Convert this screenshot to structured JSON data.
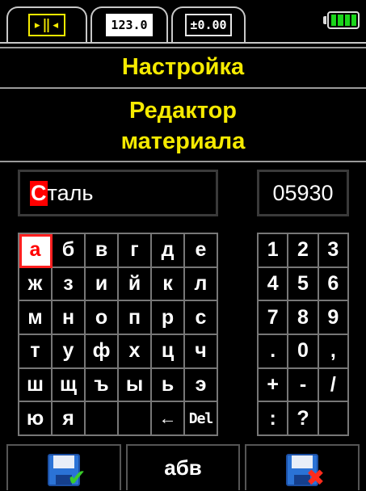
{
  "tabs": [
    {
      "glyph": "▸‖◂",
      "active": true
    },
    {
      "glyph": "123.0",
      "active": false
    },
    {
      "glyph": "±0.00",
      "active": false
    }
  ],
  "battery": {
    "level_fraction": 1.0,
    "color": "#1bd61b"
  },
  "header": {
    "title": "Настройка",
    "subtitle_line1": "Редактор",
    "subtitle_line2": "материала",
    "color": "#f5ea00"
  },
  "name_field": {
    "cursor_char": "С",
    "rest": "таль"
  },
  "code_field": {
    "value": "05930"
  },
  "alpha_keys": [
    "а",
    "б",
    "в",
    "г",
    "д",
    "е",
    "ж",
    "з",
    "и",
    "й",
    "к",
    "л",
    "м",
    "н",
    "о",
    "п",
    "р",
    "с",
    "т",
    "у",
    "ф",
    "х",
    "ц",
    "ч",
    "ш",
    "щ",
    "ъ",
    "ы",
    "ь",
    "э",
    "ю",
    "я",
    "",
    "",
    "←",
    "Del"
  ],
  "alpha_selected_index": 0,
  "num_keys": [
    "1",
    "2",
    "3",
    "4",
    "5",
    "6",
    "7",
    "8",
    "9",
    ".",
    "0",
    ",",
    "+",
    "-",
    "/",
    ":",
    "?",
    ""
  ],
  "bottom": {
    "save_icon": "save-confirm-icon",
    "mode_label": "абв",
    "cancel_icon": "save-cancel-icon"
  }
}
